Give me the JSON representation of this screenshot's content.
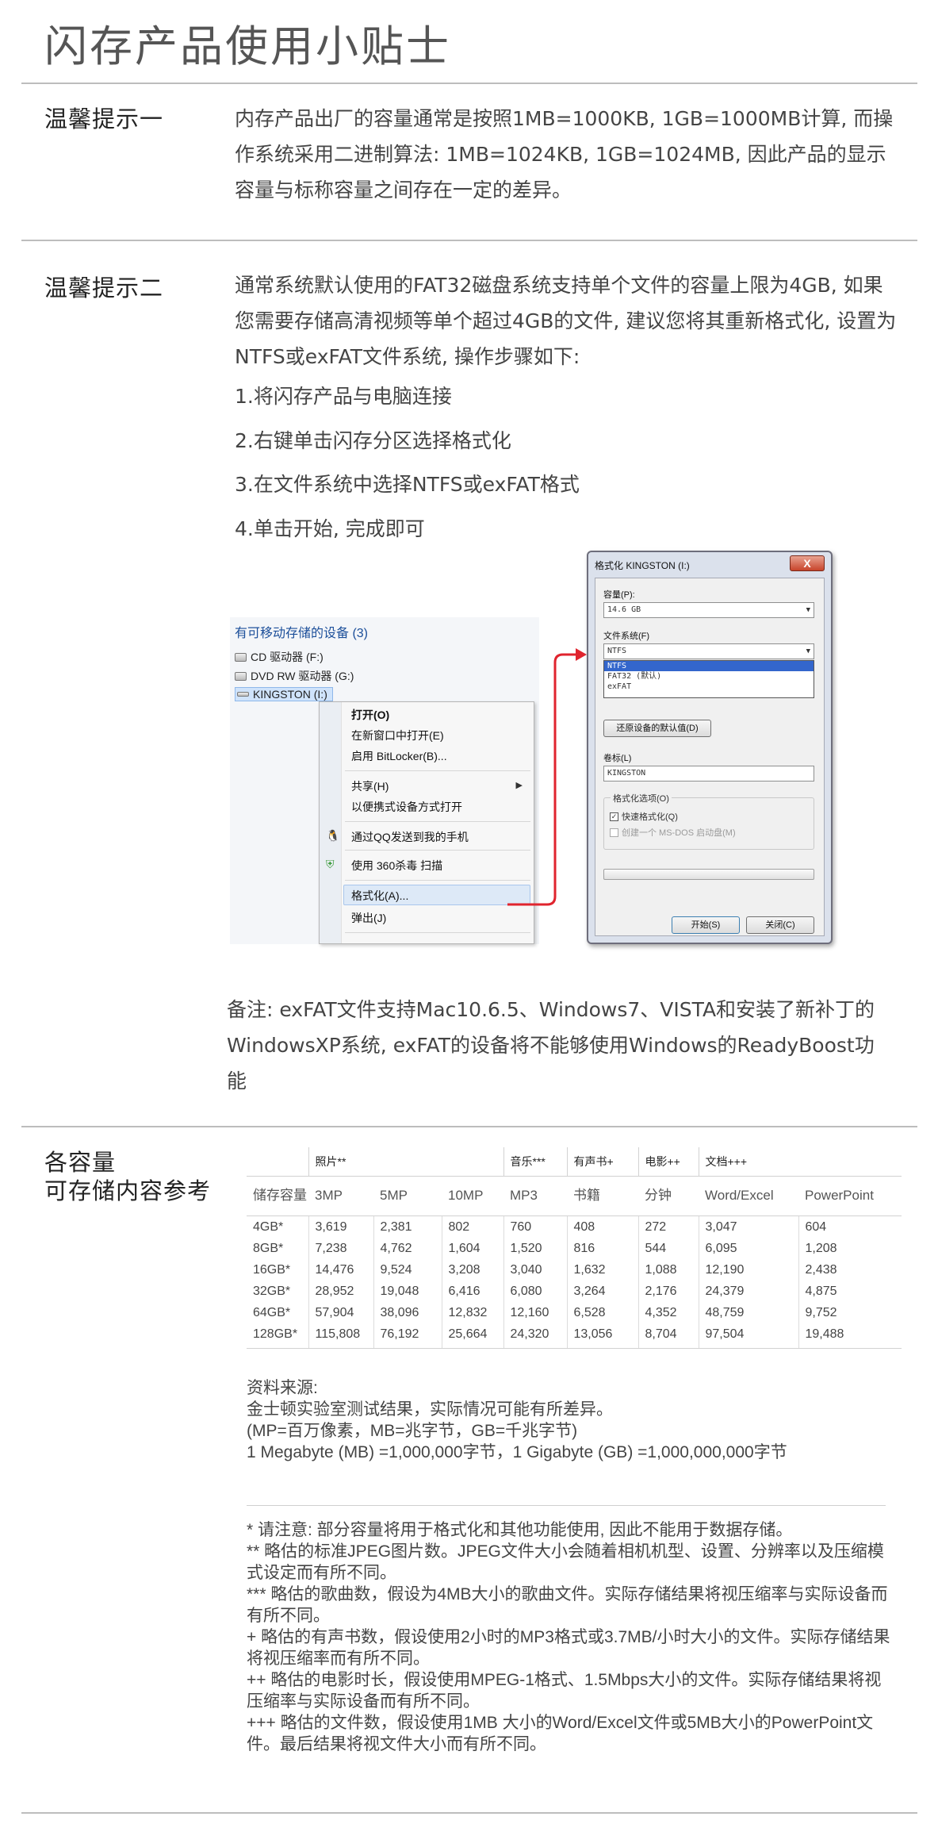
{
  "page_title": "闪存产品使用小贴士",
  "tip1": {
    "label": "温馨提示一",
    "text": "内存产品出厂的容量通常是按照1MB=1000KB, 1GB=1000MB计算, 而操作系统采用二进制算法: 1MB=1024KB, 1GB=1024MB, 因此产品的显示容量与标称容量之间存在一定的差异。"
  },
  "tip2": {
    "label": "温馨提示二",
    "text": "通常系统默认使用的FAT32磁盘系统支持单个文件的容量上限为4GB, 如果您需要存储高清视频等单个超过4GB的文件, 建议您将其重新格式化, 设置为NTFS或exFAT文件系统, 操作步骤如下:",
    "steps": [
      "1.将闪存产品与电脑连接",
      "2.右键单击闪存分区选择格式化",
      "3.在文件系统中选择NTFS或exFAT格式",
      "4.单击开始, 完成即可"
    ],
    "remark": "备注: exFAT文件支持Mac10.6.5、Windows7、VISTA和安装了新补丁的WindowsXP系统, exFAT的设备将不能够使用Windows的ReadyBoost功能"
  },
  "explorer": {
    "header": "有可移动存储的设备 (3)",
    "drives": [
      "CD 驱动器 (F:)",
      "DVD RW 驱动器 (G:)",
      "KINGSTON (I:)"
    ],
    "menu": {
      "open": "打开(O)",
      "open_new": "在新窗口中打开(E)",
      "bitlocker": "启用 BitLocker(B)...",
      "share": "共享(H)",
      "portable": "以便携式设备方式打开",
      "qq": "通过QQ发送到我的手机",
      "scan360": "使用 360杀毒 扫描",
      "format": "格式化(A)...",
      "eject": "弹出(J)"
    }
  },
  "format_dialog": {
    "title": "格式化 KINGSTON (I:)",
    "close": "X",
    "capacity_label": "容量(P):",
    "capacity_value": "14.6 GB",
    "fs_label": "文件系统(F)",
    "fs_value": "NTFS",
    "fs_options": [
      "NTFS",
      "FAT32 (默认)",
      "exFAT"
    ],
    "restore_button": "还原设备的默认值(D)",
    "volume_label": "卷标(L)",
    "volume_value": "KINGSTON",
    "options_label": "格式化选项(O)",
    "quick_format": "快速格式化(Q)",
    "msdos_disk": "创建一个 MS-DOS 启动盘(M)",
    "start_button": "开始(S)",
    "close_button": "关闭(C)"
  },
  "capacity": {
    "label_line1": "各容量",
    "label_line2": "可存储内容参考",
    "groups": {
      "photo": "照片**",
      "music": "音乐***",
      "audiobook": "有声书+",
      "movie": "电影++",
      "docs": "文档+++"
    },
    "headers": [
      "储存容量",
      "3MP",
      "5MP",
      "10MP",
      "MP3",
      "书籍",
      "分钟",
      "Word/Excel",
      "PowerPoint"
    ],
    "rows": [
      [
        "4GB*",
        "3,619",
        "2,381",
        "802",
        "760",
        "408",
        "272",
        "3,047",
        "604"
      ],
      [
        "8GB*",
        "7,238",
        "4,762",
        "1,604",
        "1,520",
        "816",
        "544",
        "6,095",
        "1,208"
      ],
      [
        "16GB*",
        "14,476",
        "9,524",
        "3,208",
        "3,040",
        "1,632",
        "1,088",
        "12,190",
        "2,438"
      ],
      [
        "32GB*",
        "28,952",
        "19,048",
        "6,416",
        "6,080",
        "3,264",
        "2,176",
        "24,379",
        "4,875"
      ],
      [
        "64GB*",
        "57,904",
        "38,096",
        "12,832",
        "12,160",
        "6,528",
        "4,352",
        "48,759",
        "9,752"
      ],
      [
        "128GB*",
        "115,808",
        "76,192",
        "25,664",
        "24,320",
        "13,056",
        "8,704",
        "97,504",
        "19,488"
      ]
    ],
    "source_title": "资料来源:",
    "source_lines": [
      "金士顿实验室测试结果，实际情况可能有所差异。",
      "(MP=百万像素，MB=兆字节，GB=千兆字节)",
      "1 Megabyte (MB) =1,000,000字节，1 Gigabyte (GB) =1,000,000,000字节"
    ],
    "notes": [
      "* 请注意: 部分容量将用于格式化和其他功能使用, 因此不能用于数据存储。",
      "** 略估的标准JPEG图片数。JPEG文件大小会随着相机机型、设置、分辨率以及压缩模式设定而有所不同。",
      "*** 略估的歌曲数，假设为4MB大小的歌曲文件。实际存储结果将视压缩率与实际设备而有所不同。",
      "+ 略估的有声书数，假设使用2小时的MP3格式或3.7MB/小时大小的文件。实际存储结果将视压缩率而有所不同。",
      "++ 略估的电影时长，假设使用MPEG-1格式、1.5Mbps大小的文件。实际存储结果将视压缩率与实际设备而有所不同。",
      "+++ 略估的文件数，假设使用1MB 大小的Word/Excel文件或5MB大小的PowerPoint文件。最后结果将视文件大小而有所不同。"
    ]
  },
  "colors": {
    "accent_red": "#e0242e",
    "link_blue": "#1c4f9a",
    "rule_gray": "#bdbdbd"
  }
}
